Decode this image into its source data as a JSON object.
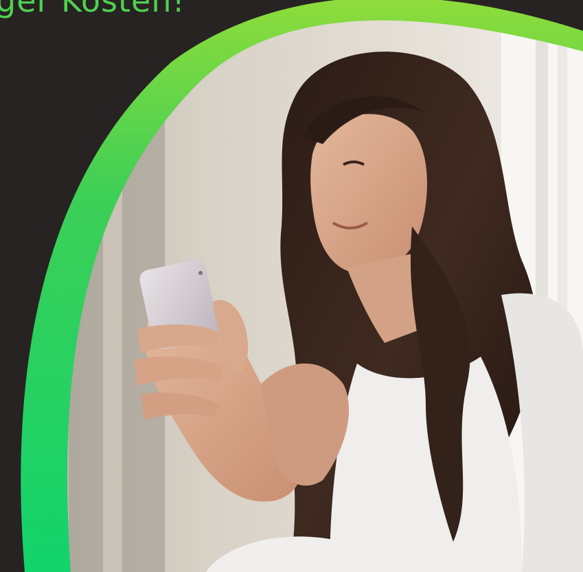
{
  "headline": "ger Kosten!",
  "colors": {
    "background": "#262322",
    "headline": "#4fd14f",
    "ring_start": "#8fdc3a",
    "ring_mid": "#3ccf57",
    "ring_end": "#12d36b"
  },
  "hero_image": {
    "icon": "woman-smiling-at-phone-photo"
  }
}
